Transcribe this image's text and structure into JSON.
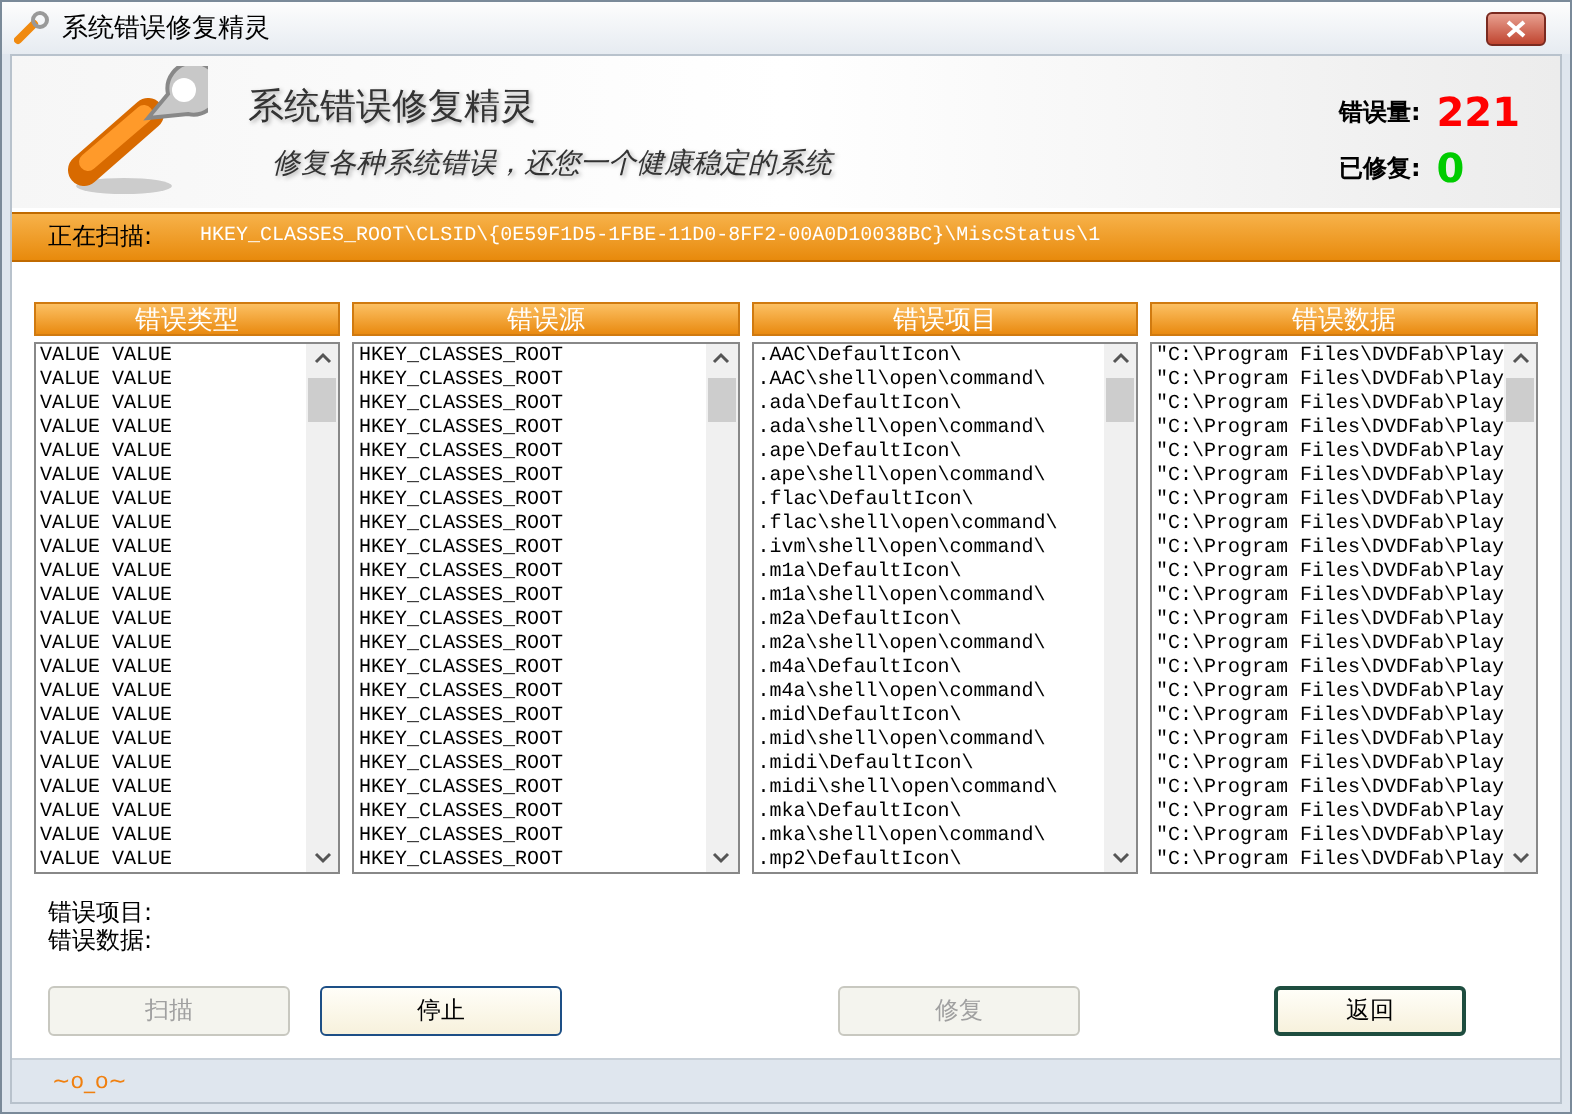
{
  "window": {
    "title": "系统错误修复精灵"
  },
  "header": {
    "title": "系统错误修复精灵",
    "subtitle": "修复各种系统错误，还您一个健康稳定的系统"
  },
  "counters": [
    {
      "label": "错误量:",
      "value": "221",
      "color": "#ff0000"
    },
    {
      "label": "已修复:",
      "value": "0",
      "color": "#00cc00"
    }
  ],
  "scan": {
    "label": "正在扫描:",
    "path": "HKEY_CLASSES_ROOT\\CLSID\\{0E59F1D5-1FBE-11D0-8FF2-00A0D10038BC}\\MiscStatus\\1"
  },
  "lists": [
    {
      "heading": "错误类型",
      "items": [
        "VALUE VALUE",
        "VALUE VALUE",
        "VALUE VALUE",
        "VALUE VALUE",
        "VALUE VALUE",
        "VALUE VALUE",
        "VALUE VALUE",
        "VALUE VALUE",
        "VALUE VALUE",
        "VALUE VALUE",
        "VALUE VALUE",
        "VALUE VALUE",
        "VALUE VALUE",
        "VALUE VALUE",
        "VALUE VALUE",
        "VALUE VALUE",
        "VALUE VALUE",
        "VALUE VALUE",
        "VALUE VALUE",
        "VALUE VALUE",
        "VALUE VALUE",
        "VALUE VALUE"
      ]
    },
    {
      "heading": "错误源",
      "items": [
        "HKEY_CLASSES_ROOT",
        "HKEY_CLASSES_ROOT",
        "HKEY_CLASSES_ROOT",
        "HKEY_CLASSES_ROOT",
        "HKEY_CLASSES_ROOT",
        "HKEY_CLASSES_ROOT",
        "HKEY_CLASSES_ROOT",
        "HKEY_CLASSES_ROOT",
        "HKEY_CLASSES_ROOT",
        "HKEY_CLASSES_ROOT",
        "HKEY_CLASSES_ROOT",
        "HKEY_CLASSES_ROOT",
        "HKEY_CLASSES_ROOT",
        "HKEY_CLASSES_ROOT",
        "HKEY_CLASSES_ROOT",
        "HKEY_CLASSES_ROOT",
        "HKEY_CLASSES_ROOT",
        "HKEY_CLASSES_ROOT",
        "HKEY_CLASSES_ROOT",
        "HKEY_CLASSES_ROOT",
        "HKEY_CLASSES_ROOT",
        "HKEY_CLASSES_ROOT"
      ]
    },
    {
      "heading": "错误项目",
      "items": [
        ".AAC\\DefaultIcon\\",
        ".AAC\\shell\\open\\command\\",
        ".ada\\DefaultIcon\\",
        ".ada\\shell\\open\\command\\",
        ".ape\\DefaultIcon\\",
        ".ape\\shell\\open\\command\\",
        ".flac\\DefaultIcon\\",
        ".flac\\shell\\open\\command\\",
        ".ivm\\shell\\open\\command\\",
        ".m1a\\DefaultIcon\\",
        ".m1a\\shell\\open\\command\\",
        ".m2a\\DefaultIcon\\",
        ".m2a\\shell\\open\\command\\",
        ".m4a\\DefaultIcon\\",
        ".m4a\\shell\\open\\command\\",
        ".mid\\DefaultIcon\\",
        ".mid\\shell\\open\\command\\",
        ".midi\\DefaultIcon\\",
        ".midi\\shell\\open\\command\\",
        ".mka\\DefaultIcon\\",
        ".mka\\shell\\open\\command\\",
        ".mp2\\DefaultIcon\\"
      ]
    },
    {
      "heading": "错误数据",
      "items": [
        "\"C:\\Program Files\\DVDFab\\Play",
        "\"C:\\Program Files\\DVDFab\\Play",
        "\"C:\\Program Files\\DVDFab\\Play",
        "\"C:\\Program Files\\DVDFab\\Play",
        "\"C:\\Program Files\\DVDFab\\Play",
        "\"C:\\Program Files\\DVDFab\\Play",
        "\"C:\\Program Files\\DVDFab\\Play",
        "\"C:\\Program Files\\DVDFab\\Play",
        "\"C:\\Program Files\\DVDFab\\Play",
        "\"C:\\Program Files\\DVDFab\\Play",
        "\"C:\\Program Files\\DVDFab\\Play",
        "\"C:\\Program Files\\DVDFab\\Play",
        "\"C:\\Program Files\\DVDFab\\Play",
        "\"C:\\Program Files\\DVDFab\\Play",
        "\"C:\\Program Files\\DVDFab\\Play",
        "\"C:\\Program Files\\DVDFab\\Play",
        "\"C:\\Program Files\\DVDFab\\Play",
        "\"C:\\Program Files\\DVDFab\\Play",
        "\"C:\\Program Files\\DVDFab\\Play",
        "\"C:\\Program Files\\DVDFab\\Play",
        "\"C:\\Program Files\\DVDFab\\Play",
        "\"C:\\Program Files\\DVDFab\\Play"
      ]
    }
  ],
  "details": [
    "错误项目:",
    "错误数据:"
  ],
  "buttons": [
    {
      "label": "扫描",
      "disabled": true,
      "default": false
    },
    {
      "label": "停止",
      "disabled": false,
      "default": false
    },
    {
      "label": "修复",
      "disabled": true,
      "default": false
    },
    {
      "label": "返回",
      "disabled": false,
      "default": true
    }
  ],
  "status": "~o_o~"
}
